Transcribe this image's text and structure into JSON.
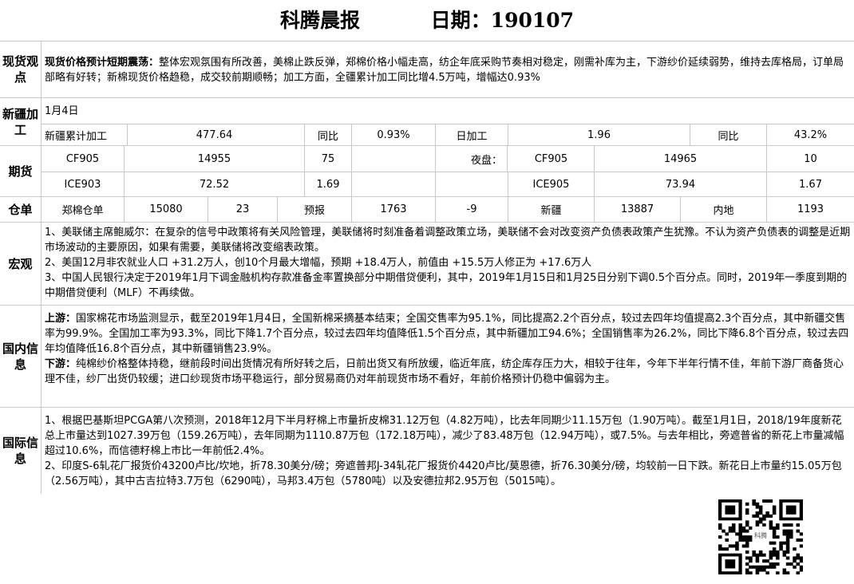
{
  "header": {
    "title": "科腾晨报",
    "date": "日期：190107"
  },
  "spot": {
    "label": "现货观点",
    "lead": "现货价格预计短期震荡：",
    "text": "整体宏观氛围有所改善，美棉止跌反弹，郑棉价格小幅走高，纺企年底采购节奏相对稳定，刚需补库为主，下游纱价延续弱势，维持去库格局，订单局部略有好转；新棉现货价格趋稳，成交较前期顺畅；加工方面，全疆累计加工同比增4.5万吨，增幅达0.93%"
  },
  "xinjiang": {
    "label": "新疆加工",
    "date": "1月4日",
    "cells": [
      "新疆累计加工",
      "477.64",
      "同比",
      "0.93%",
      "日加工",
      "1.96",
      "同比",
      "43.2%"
    ]
  },
  "futures": {
    "label": "期货",
    "row1": [
      "CF905",
      "14955",
      "75",
      "",
      "夜盘：",
      "CF905",
      "14965",
      "10"
    ],
    "row2": [
      "ICE903",
      "72.52",
      "1.69",
      "",
      "",
      "ICE905",
      "73.94",
      "1.67"
    ]
  },
  "warehouse": {
    "label": "仓单",
    "cells": [
      "郑棉仓单",
      "15080",
      "23",
      "预报",
      "1763",
      "-9",
      "新疆",
      "13887",
      "内地",
      "1193"
    ]
  },
  "macro": {
    "label": "宏观",
    "lines": [
      "1、美联储主席鲍威尔：在复杂的信号中政策将有关风险管理，美联储将时刻准备着调整政策立场，美联储不会对改变资产负债表政策产生犹豫。不认为资产负债表的调整是近期市场波动的主要原因，如果有需要，美联储将改变缩表政策。",
      "2、美国12月非农就业人口 +31.2万人，创10个月最大增幅，预期 +18.4万人，前值由 +15.5万人修正为 +17.6万人",
      "3、中国人民银行决定于2019年1月下调金融机构存款准备金率置换部分中期借贷便利，其中，2019年1月15日和1月25日分别下调0.5个百分点。同时，2019年一季度到期的中期借贷便利（MLF）不再续做。"
    ]
  },
  "domestic": {
    "label": "国内信息",
    "up_lead": "上游：",
    "up_text": "国家棉花市场监测显示，截至2019年1月4日，全国新棉采摘基本结束；全国交售率为95.1%，同比提高2.2个百分点，较过去四年均值提高2.3个百分点，其中新疆交售率为99.9%。全国加工率为93.3%，同比下降1.7个百分点，较过去四年均值降低1.5个百分点，其中新疆加工94.6%；全国销售率为26.2%，同比下降6.8个百分点，较过去四年均值降低16.8个百分点，其中新疆销售23.9%。",
    "down_lead": "下游：",
    "down_text": "纯棉纱价格整体持稳，继前段时间出货情况有所好转之后，日前出货又有所放缓，临近年底，纺企库存压力大，相较于往年，今年下半年行情不佳，年前下游厂商备货心理不佳，纱厂出货仍较缓；进口纱现货市场平稳运行，部分贸易商仍对年前现货市场不看好，年前价格预计仍稳中偏弱为主。"
  },
  "intl": {
    "label": "国际信息",
    "lines": [
      "1、根据巴基斯坦PCGA第八次预测，2018年12月下半月籽棉上市量折皮棉31.12万包（4.82万吨），比去年同期少11.15万包（1.90万吨）。截至1月1日，2018/19年度新花总上市量达到1027.39万包（159.26万吨），去年同期为1110.87万包（172.18万吨），减少了83.48万包（12.94万吨），或7.5%。与去年相比，旁遮普省的新花上市量减幅超过10.6%，而信德籽棉上市比一年前低2.4%。",
      "2、印度S-6轧花厂报货价43200卢比/坎地，折78.30美分/磅；旁遮普邦J-34轧花厂报货价4420卢比/莫恩德，折76.30美分/磅，均较前一日下跌。新花日上市量约15.05万包（2.56万吨），其中古吉拉特3.7万包（6290吨），马邦3.4万包（5780吨）以及安德拉邦2.95万包（5015吨）。"
    ]
  },
  "qr": {
    "center_text": "科腾",
    "icon": "qr-code-icon"
  }
}
